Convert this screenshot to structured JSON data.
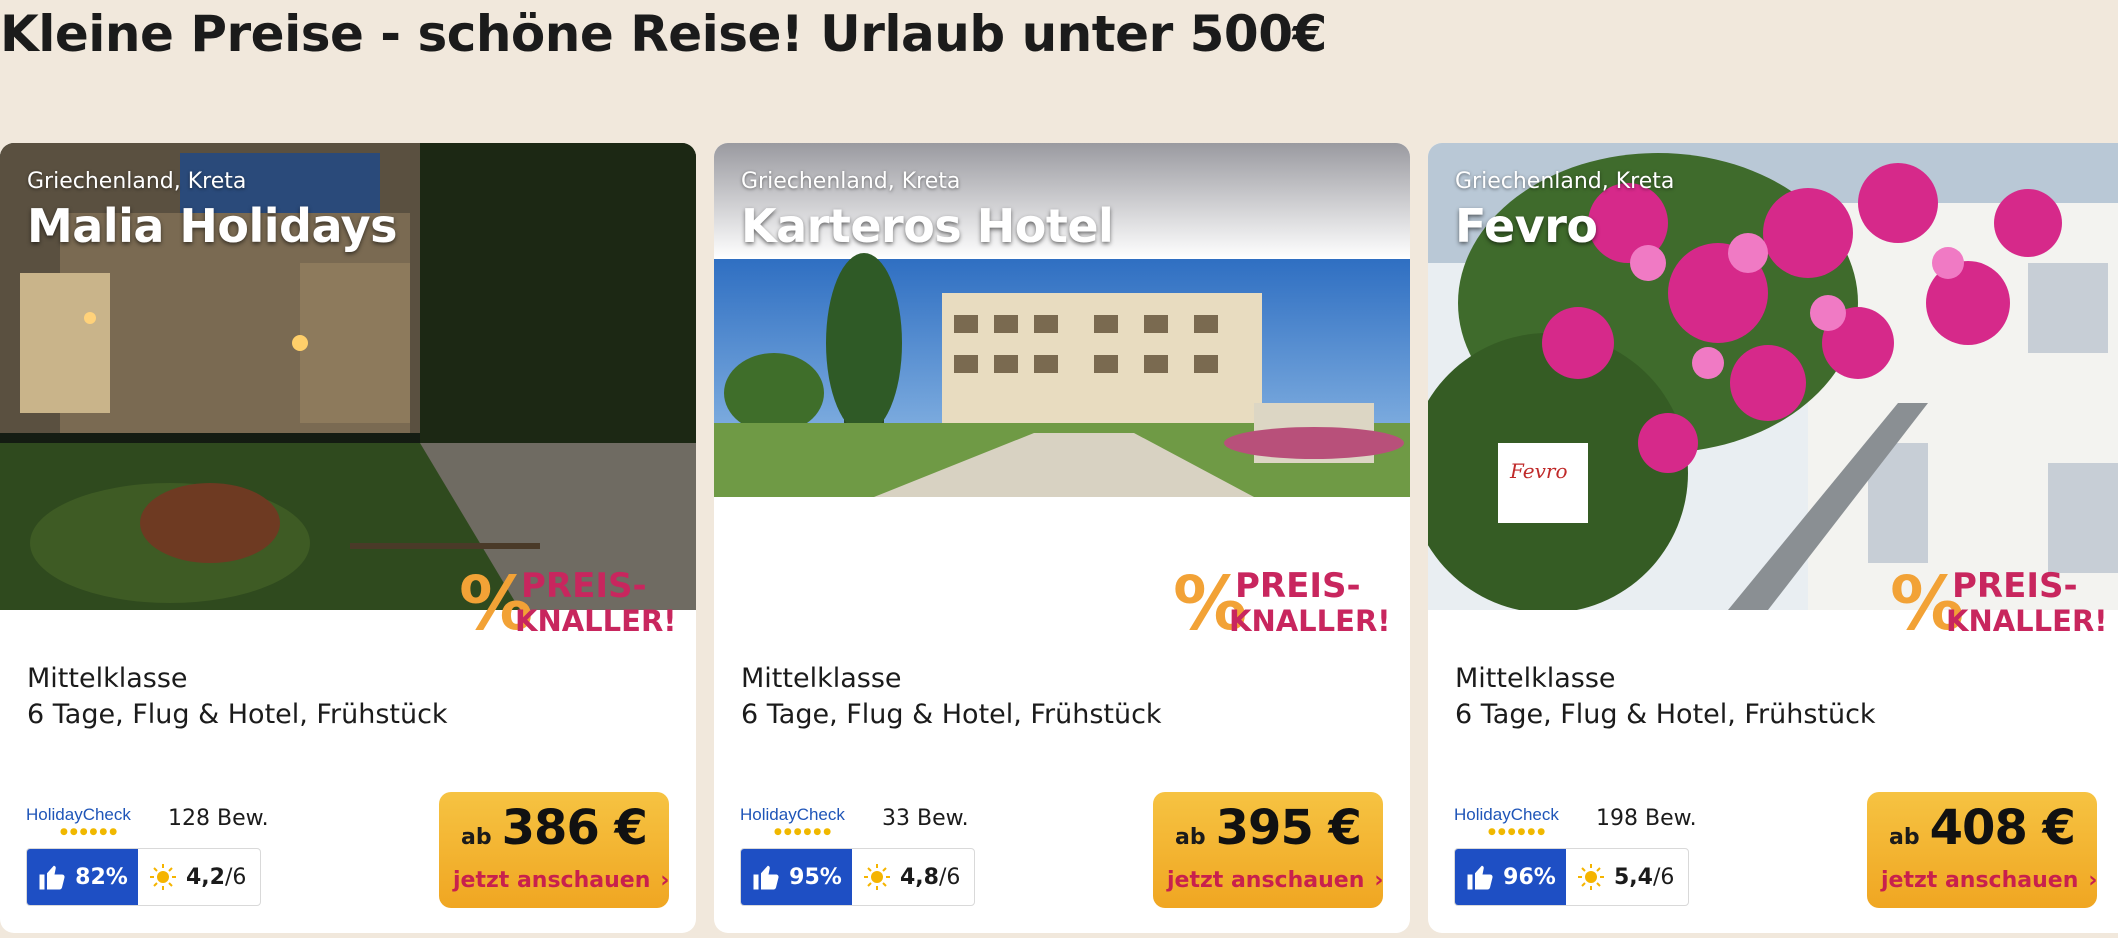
{
  "page": {
    "title": "Kleine Preise - schöne Reise! Urlaub unter 500€"
  },
  "badge": {
    "line1": "PREIS-",
    "line2": "KNALLER!"
  },
  "cards": [
    {
      "location": "Griechenland, Kreta",
      "name": "Malia Holidays",
      "category": "Mittelklasse",
      "details": "6 Tage, Flug & Hotel, Frühstück",
      "hc_logo": "HolidayCheck",
      "reviews": "128 Bew.",
      "recommend": "82%",
      "sun_score": "4,2",
      "sun_max": "/6",
      "price_prefix": "ab",
      "price": "386 €",
      "cta": "jetzt anschauen"
    },
    {
      "location": "Griechenland, Kreta",
      "name": "Karteros Hotel",
      "category": "Mittelklasse",
      "details": "6 Tage, Flug & Hotel, Frühstück",
      "hc_logo": "HolidayCheck",
      "reviews": "33 Bew.",
      "recommend": "95%",
      "sun_score": "4,8",
      "sun_max": "/6",
      "price_prefix": "ab",
      "price": "395 €",
      "cta": "jetzt anschauen"
    },
    {
      "location": "Griechenland, Kreta",
      "name": "Fevro",
      "category": "Mittelklasse",
      "details": "6 Tage, Flug & Hotel, Frühstück",
      "hc_logo": "HolidayCheck",
      "reviews": "198 Bew.",
      "recommend": "96%",
      "sun_score": "5,4",
      "sun_max": "/6",
      "price_prefix": "ab",
      "price": "408 €",
      "cta": "jetzt anschauen"
    }
  ],
  "colors": {
    "background": "#f1e8dc",
    "recommend_blue": "#1e4fc4",
    "price_yellow": "#f6c342",
    "cta_red": "#c8204d",
    "badge_magenta": "#c8265e",
    "badge_orange": "#f2a236"
  }
}
